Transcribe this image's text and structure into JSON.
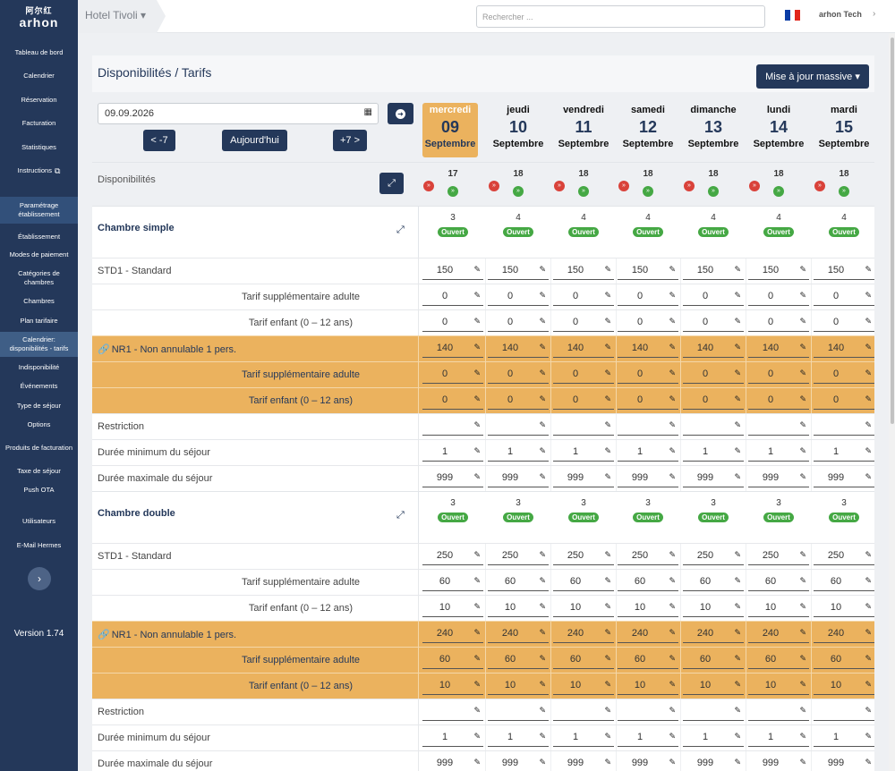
{
  "app": {
    "logo_glyphs": "阿尔红",
    "logo_text": "arhon",
    "version": "Version 1.74"
  },
  "sidebar": {
    "items": [
      {
        "label": "Tableau de bord"
      },
      {
        "label": "Calendrier"
      },
      {
        "label": "Réservation"
      },
      {
        "label": "Facturation"
      },
      {
        "label": "Statistiques"
      },
      {
        "label": "Instructions"
      },
      {
        "label": "Paramétrage établissement"
      },
      {
        "label": "Établissement"
      },
      {
        "label": "Modes de paiement"
      },
      {
        "label": "Catégories de chambres"
      },
      {
        "label": "Chambres"
      },
      {
        "label": "Plan tarifaire"
      },
      {
        "label": "Calendrier: disponibilités - tarifs"
      },
      {
        "label": "Indisponibilité"
      },
      {
        "label": "Événements"
      },
      {
        "label": "Type de séjour"
      },
      {
        "label": "Options"
      },
      {
        "label": "Produits de facturation"
      },
      {
        "label": "Taxe de séjour"
      },
      {
        "label": "Push OTA"
      },
      {
        "label": "Utilisateurs"
      },
      {
        "label": "E-Mail Hermes"
      }
    ]
  },
  "topbar": {
    "hotel": "Hotel Tivoli",
    "search_placeholder": "Rechercher ...",
    "user": "arhon Tech",
    "flag_colors": [
      "#0a3ca5",
      "#ffffff",
      "#e1261c"
    ]
  },
  "page": {
    "title": "Disponibilités / Tarifs",
    "bulk_button": "Mise à jour massive"
  },
  "controls": {
    "date": "09.09.2026",
    "prev": "< -7",
    "today": "Aujourd'hui",
    "next": "+7 >"
  },
  "days": [
    {
      "weekday": "mercredi",
      "day": "09",
      "month": "Septembre",
      "avail": "17",
      "selected": true
    },
    {
      "weekday": "jeudi",
      "day": "10",
      "month": "Septembre",
      "avail": "18"
    },
    {
      "weekday": "vendredi",
      "day": "11",
      "month": "Septembre",
      "avail": "18"
    },
    {
      "weekday": "samedi",
      "day": "12",
      "month": "Septembre",
      "avail": "18"
    },
    {
      "weekday": "dimanche",
      "day": "13",
      "month": "Septembre",
      "avail": "18"
    },
    {
      "weekday": "lundi",
      "day": "14",
      "month": "Septembre",
      "avail": "18"
    },
    {
      "weekday": "mardi",
      "day": "15",
      "month": "Septembre",
      "avail": "18"
    }
  ],
  "availability_label": "Disponibilités",
  "colors": {
    "accent": "#24385a",
    "highlight": "#ebb25e",
    "open_badge": "#45a844",
    "down_arrow": "#d9423a"
  },
  "rooms": [
    {
      "name": "Chambre simple",
      "counts": [
        "3",
        "4",
        "4",
        "4",
        "4",
        "4",
        "4"
      ],
      "status": "Ouvert",
      "rows": [
        {
          "label": "STD1 - Standard",
          "kind": "rate",
          "values": [
            "150",
            "150",
            "150",
            "150",
            "150",
            "150",
            "150"
          ]
        },
        {
          "label": "Tarif supplémentaire adulte",
          "kind": "sub",
          "values": [
            "0",
            "0",
            "0",
            "0",
            "0",
            "0",
            "0"
          ]
        },
        {
          "label": "Tarif enfant (0 – 12 ans)",
          "kind": "sub",
          "values": [
            "0",
            "0",
            "0",
            "0",
            "0",
            "0",
            "0"
          ]
        },
        {
          "label": "NR1 - Non annulable 1 pers.",
          "kind": "rate-hl",
          "values": [
            "140",
            "140",
            "140",
            "140",
            "140",
            "140",
            "140"
          ]
        },
        {
          "label": "Tarif supplémentaire adulte",
          "kind": "sub-hl",
          "values": [
            "0",
            "0",
            "0",
            "0",
            "0",
            "0",
            "0"
          ]
        },
        {
          "label": "Tarif enfant (0 – 12 ans)",
          "kind": "sub-hl",
          "values": [
            "0",
            "0",
            "0",
            "0",
            "0",
            "0",
            "0"
          ]
        },
        {
          "label": "Restriction",
          "kind": "plain",
          "values": [
            "",
            "",
            "",
            "",
            "",
            "",
            ""
          ]
        },
        {
          "label": "Durée minimum du séjour",
          "kind": "plain",
          "values": [
            "1",
            "1",
            "1",
            "1",
            "1",
            "1",
            "1"
          ]
        },
        {
          "label": "Durée maximale du séjour",
          "kind": "plain",
          "values": [
            "999",
            "999",
            "999",
            "999",
            "999",
            "999",
            "999"
          ]
        }
      ]
    },
    {
      "name": "Chambre double",
      "counts": [
        "3",
        "3",
        "3",
        "3",
        "3",
        "3",
        "3"
      ],
      "status": "Ouvert",
      "rows": [
        {
          "label": "STD1 - Standard",
          "kind": "rate",
          "values": [
            "250",
            "250",
            "250",
            "250",
            "250",
            "250",
            "250"
          ]
        },
        {
          "label": "Tarif supplémentaire adulte",
          "kind": "sub",
          "values": [
            "60",
            "60",
            "60",
            "60",
            "60",
            "60",
            "60"
          ]
        },
        {
          "label": "Tarif enfant (0 – 12 ans)",
          "kind": "sub",
          "values": [
            "10",
            "10",
            "10",
            "10",
            "10",
            "10",
            "10"
          ]
        },
        {
          "label": "NR1 - Non annulable 1 pers.",
          "kind": "rate-hl",
          "values": [
            "240",
            "240",
            "240",
            "240",
            "240",
            "240",
            "240"
          ]
        },
        {
          "label": "Tarif supplémentaire adulte",
          "kind": "sub-hl",
          "values": [
            "60",
            "60",
            "60",
            "60",
            "60",
            "60",
            "60"
          ]
        },
        {
          "label": "Tarif enfant (0 – 12 ans)",
          "kind": "sub-hl",
          "values": [
            "10",
            "10",
            "10",
            "10",
            "10",
            "10",
            "10"
          ]
        },
        {
          "label": "Restriction",
          "kind": "plain",
          "values": [
            "",
            "",
            "",
            "",
            "",
            "",
            ""
          ]
        },
        {
          "label": "Durée minimum du séjour",
          "kind": "plain",
          "values": [
            "1",
            "1",
            "1",
            "1",
            "1",
            "1",
            "1"
          ]
        },
        {
          "label": "Durée maximale du séjour",
          "kind": "plain",
          "values": [
            "999",
            "999",
            "999",
            "999",
            "999",
            "999",
            "999"
          ]
        }
      ]
    }
  ]
}
